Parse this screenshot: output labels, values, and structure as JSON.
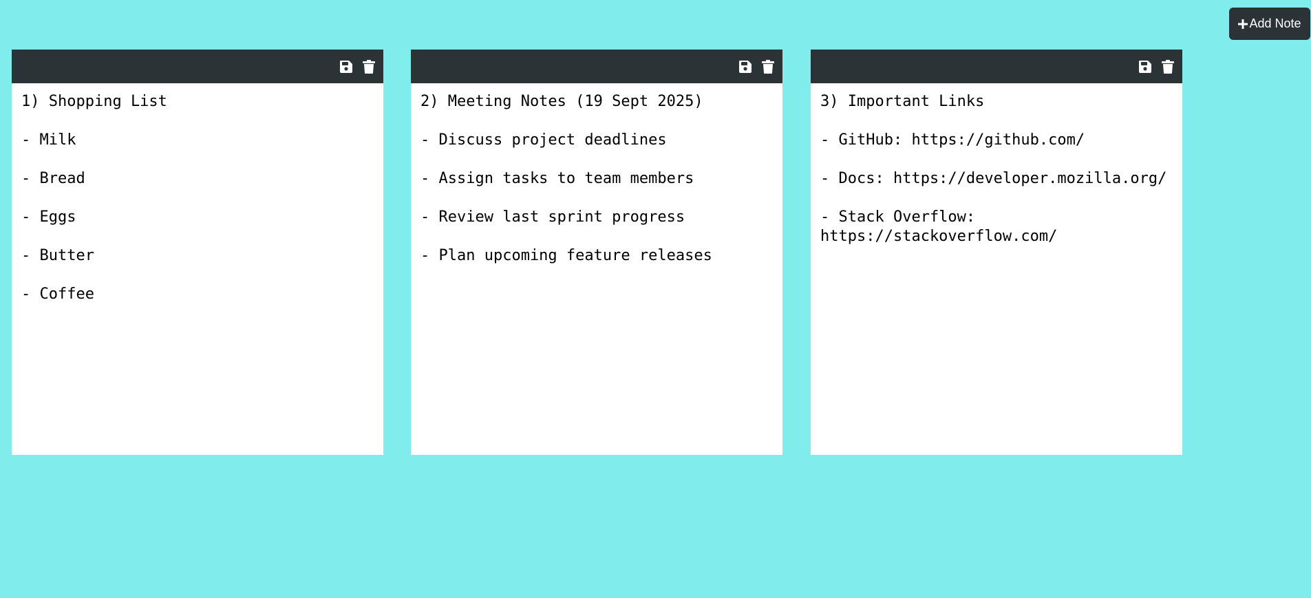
{
  "header": {
    "add_note_label": "Add Note",
    "add_note_icon": "plus-icon"
  },
  "colors": {
    "background": "#80ecec",
    "toolbar": "#2c3337",
    "note": "#ffffff",
    "text": "#000000"
  },
  "notes": [
    {
      "save_icon": "floppy-disk-icon",
      "delete_icon": "trash-icon",
      "text": "1) Shopping List\n\n- Milk\n\n- Bread\n\n- Eggs\n\n- Butter\n\n- Coffee"
    },
    {
      "save_icon": "floppy-disk-icon",
      "delete_icon": "trash-icon",
      "text": "2) Meeting Notes (19 Sept 2025)\n\n- Discuss project deadlines\n\n- Assign tasks to team members\n\n- Review last sprint progress\n\n- Plan upcoming feature releases"
    },
    {
      "save_icon": "floppy-disk-icon",
      "delete_icon": "trash-icon",
      "text": "3) Important Links\n\n- GitHub: https://github.com/\n\n- Docs: https://developer.mozilla.org/\n\n- Stack Overflow:\nhttps://stackoverflow.com/"
    }
  ]
}
